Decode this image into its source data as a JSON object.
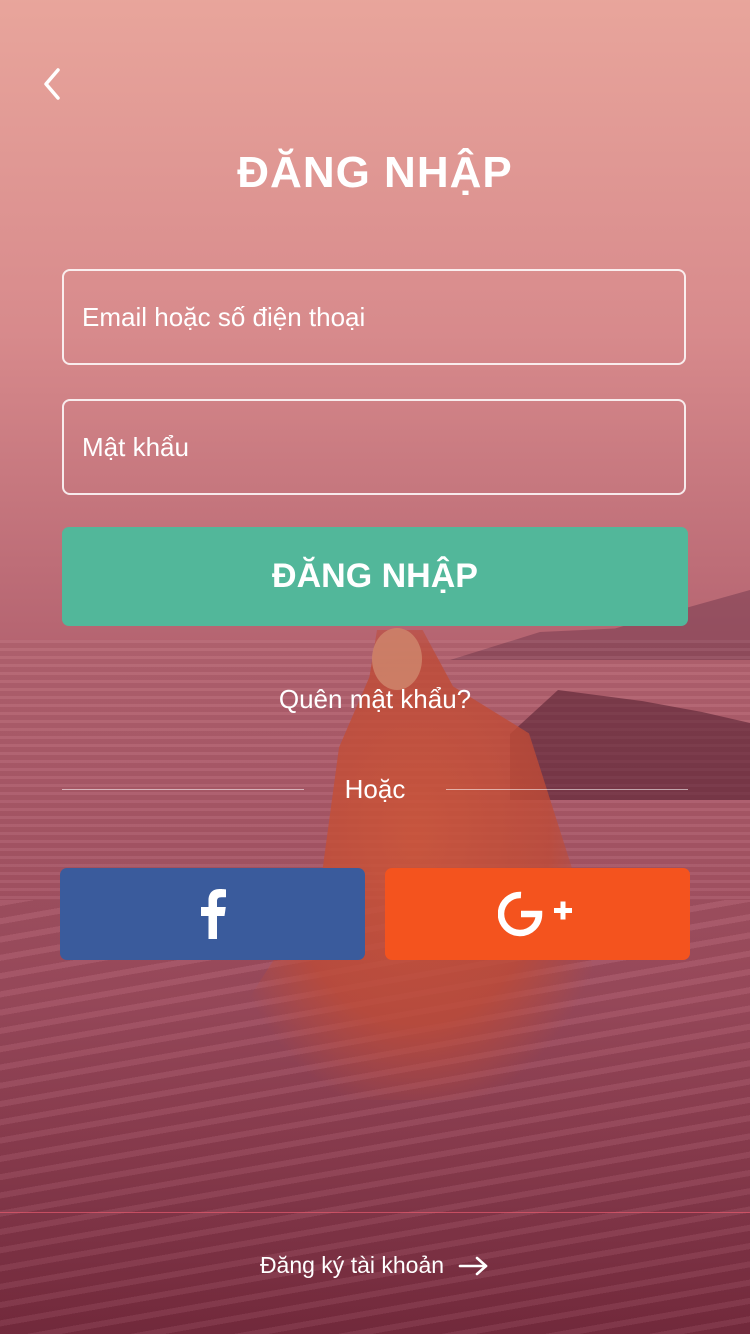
{
  "header": {
    "back_icon": "chevron-left-icon",
    "title": "ĐĂNG NHẬP"
  },
  "form": {
    "email_placeholder": "Email hoặc số điện thoại",
    "email_value": "",
    "password_placeholder": "Mật khẩu",
    "password_value": "",
    "login_label": "ĐĂNG NHẬP",
    "login_color": "#52b79a",
    "forgot_label": "Quên mật khẩu?"
  },
  "divider": {
    "label": "Hoặc"
  },
  "social": {
    "facebook_icon": "facebook-icon",
    "facebook_color": "#3a5b9c",
    "google_icon": "google-plus-icon",
    "google_color": "#f4531e"
  },
  "footer": {
    "register_label": "Đăng ký tài khoản",
    "arrow_icon": "arrow-right-icon"
  }
}
